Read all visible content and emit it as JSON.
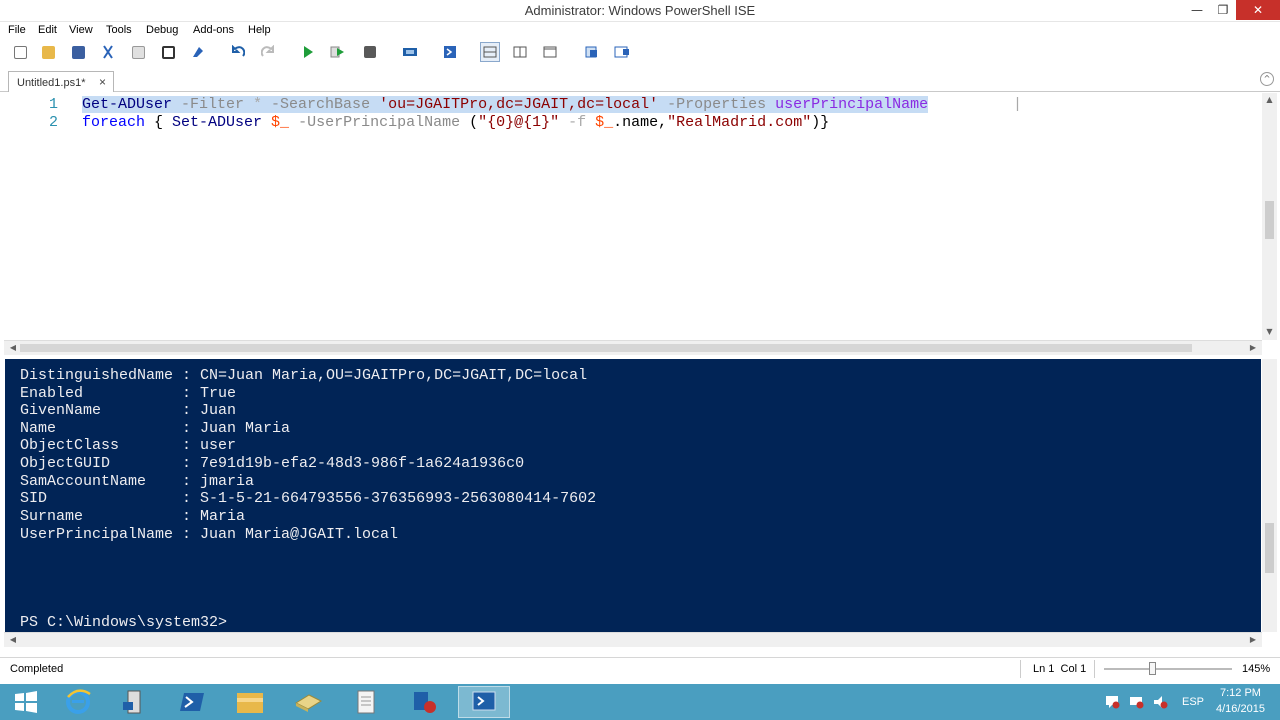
{
  "window": {
    "title": "Administrator: Windows PowerShell ISE",
    "min": "—",
    "max": "❐",
    "close": "✕"
  },
  "menu": [
    "File",
    "Edit",
    "View",
    "Tools",
    "Debug",
    "Add-ons",
    "Help"
  ],
  "toolbar": {
    "icons": [
      "new-file-icon",
      "open-folder-icon",
      "save-icon",
      "cut-icon",
      "copy-icon",
      "paste-icon",
      "clear-console-icon",
      "undo-icon",
      "redo-icon",
      "run-script-icon",
      "run-selection-icon",
      "stop-icon",
      "remote-powershell-icon",
      "powershell-console-icon",
      "layout-top-icon",
      "layout-right-icon",
      "layout-max-icon",
      "show-script-pane-icon",
      "show-commands-icon"
    ],
    "colors": {
      "run": "#1f9d3a",
      "stop": "#595959",
      "accent": "#1f5fa8"
    }
  },
  "tab": {
    "label": "Untitled1.ps1*",
    "close": "×",
    "collapse": "^"
  },
  "editor": {
    "line_numbers": [
      "1",
      "2"
    ],
    "line1": {
      "cmd": "Get-ADUser",
      "p1": " -Filter",
      "op": " *",
      "p2": " -SearchBase",
      "str": " 'ou=JGAITPro,dc=JGAIT,dc=local'",
      "p3": " -Properties",
      "prop": " userPrincipalName",
      "pipe": " |"
    },
    "line2": {
      "kw": "foreach",
      "b1": " { ",
      "cmd": "Set-ADUser",
      "var1": " $_",
      "p1": " -UserPrincipalName",
      "pr1": " (",
      "str1": "\"{0}@{1}\"",
      "fop": " -f",
      "var2": " $_",
      "dot": ".name,",
      "str2": "\"RealMadrid.com\"",
      "pr2": ")}"
    }
  },
  "console": {
    "lines": [
      "DistinguishedName : CN=Juan Maria,OU=JGAITPro,DC=JGAIT,DC=local",
      "Enabled           : True",
      "GivenName         : Juan",
      "Name              : Juan Maria",
      "ObjectClass       : user",
      "ObjectGUID        : 7e91d19b-efa2-48d3-986f-1a624a1936c0",
      "SamAccountName    : jmaria",
      "SID               : S-1-5-21-664793556-376356993-2563080414-7602",
      "Surname           : Maria",
      "UserPrincipalName : Juan Maria@JGAIT.local"
    ],
    "prompt": "PS C:\\Windows\\system32>",
    "bg": "#012456"
  },
  "status": {
    "text": "Completed",
    "position": "Ln 1  Col 1",
    "zoom": "145%",
    "zoom_level": 0.35
  },
  "taskbar": {
    "apps": [
      "start-windows-icon",
      "internet-explorer-icon",
      "server-manager-icon",
      "powershell-icon",
      "file-explorer-icon",
      "active-directory-icon",
      "notepad-icon",
      "dns-manager-icon",
      "powershell-ise-icon"
    ],
    "tray": {
      "language": "ESP",
      "time": "7:12 PM",
      "date": "4/16/2015"
    },
    "bg": "#4a9ec0"
  }
}
